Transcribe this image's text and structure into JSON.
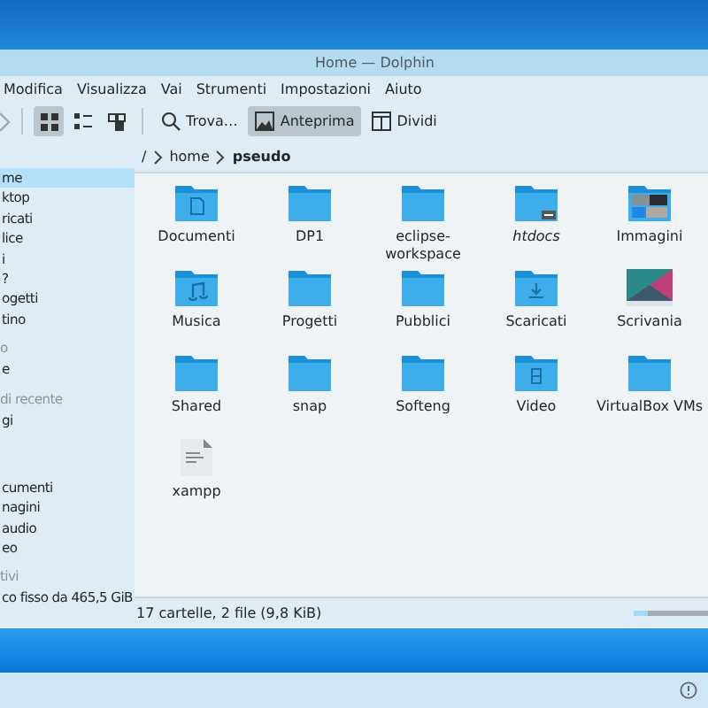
{
  "window": {
    "title": "Home — Dolphin"
  },
  "menu": [
    "Modifica",
    "Visualizza",
    "Vai",
    "Strumenti",
    "Impostazioni",
    "Aiuto"
  ],
  "view_modes": [
    {
      "kind": "icons",
      "selected": true
    },
    {
      "kind": "compact",
      "selected": false
    },
    {
      "kind": "details",
      "selected": false
    }
  ],
  "toolbar_buttons": [
    {
      "kind": "search",
      "label": "Trova…",
      "selected": false
    },
    {
      "kind": "preview",
      "label": "Anteprima",
      "selected": true
    },
    {
      "kind": "split",
      "label": "Dividi",
      "selected": false
    }
  ],
  "breadcrumb": [
    "/",
    "home",
    "pseudo"
  ],
  "sidebar": {
    "groups": [
      {
        "items": [
          {
            "label": "me",
            "selected": true
          },
          {
            "label": "ktop",
            "selected": false
          },
          {
            "label": "ricati",
            "selected": false
          },
          {
            "label": "lice",
            "selected": false
          },
          {
            "label": "i",
            "selected": false
          },
          {
            "label": "?",
            "selected": false
          },
          {
            "label": "ogetti",
            "selected": false
          },
          {
            "label": "tino",
            "selected": false
          }
        ]
      },
      {
        "heading": "o",
        "items": [
          {
            "label": "e",
            "selected": false
          }
        ]
      },
      {
        "heading": "di recente",
        "items": [
          {
            "label": "gi",
            "selected": false
          }
        ]
      },
      {
        "items": [
          {
            "label": "cumenti",
            "selected": false
          },
          {
            "label": "nagini",
            "selected": false
          },
          {
            "label": "audio",
            "selected": false
          },
          {
            "label": "eo",
            "selected": false
          }
        ]
      },
      {
        "heading": "tivi",
        "items": [
          {
            "label": "co fisso da 465,5 GiB",
            "selected": false
          }
        ]
      }
    ]
  },
  "files": [
    {
      "name": "Documenti",
      "kind": "folder-document",
      "italic": false
    },
    {
      "name": "DP1",
      "kind": "folder",
      "italic": false
    },
    {
      "name": "eclipse-workspace",
      "kind": "folder",
      "italic": false
    },
    {
      "name": "htdocs",
      "kind": "folder-link",
      "italic": true
    },
    {
      "name": "Immagini",
      "kind": "folder-images",
      "italic": false
    },
    {
      "name": "Musica",
      "kind": "folder-music",
      "italic": false
    },
    {
      "name": "Progetti",
      "kind": "folder",
      "italic": false
    },
    {
      "name": "Pubblici",
      "kind": "folder",
      "italic": false
    },
    {
      "name": "Scaricati",
      "kind": "folder-download",
      "italic": false
    },
    {
      "name": "Scrivania",
      "kind": "wallpaper",
      "italic": false
    },
    {
      "name": "Shared",
      "kind": "folder",
      "italic": false
    },
    {
      "name": "snap",
      "kind": "folder",
      "italic": false
    },
    {
      "name": "Softeng",
      "kind": "folder",
      "italic": false
    },
    {
      "name": "Video",
      "kind": "folder-video",
      "italic": false
    },
    {
      "name": "VirtualBox VMs",
      "kind": "folder",
      "italic": false
    },
    {
      "name": "xampp",
      "kind": "text-file",
      "italic": false
    }
  ],
  "status_bar": {
    "text": "17 cartelle, 2 file (9,8 KiB)",
    "free_space": {
      "level": 0.2
    }
  }
}
